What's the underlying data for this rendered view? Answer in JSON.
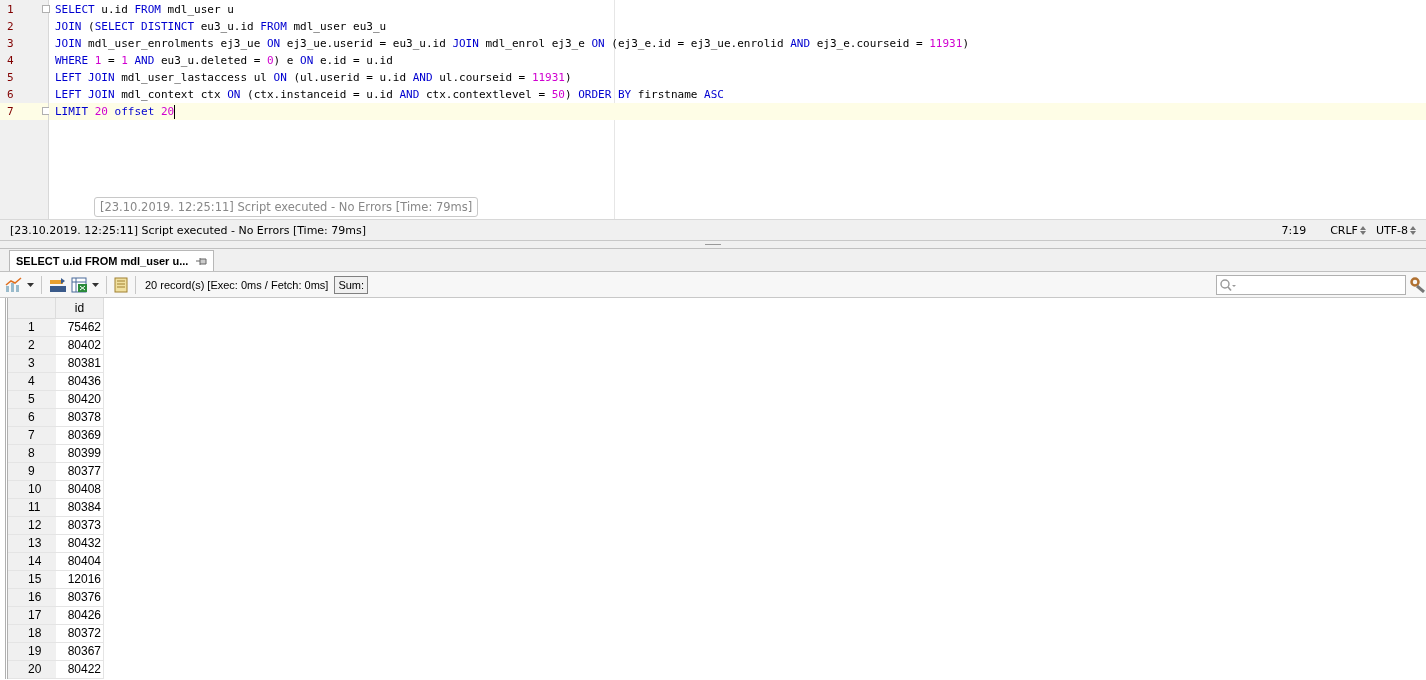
{
  "editor": {
    "lines": [
      {
        "number": "1",
        "fold": true,
        "current": false,
        "tokens": [
          {
            "kind": "keyword",
            "text": "SELECT"
          },
          {
            "kind": "plain",
            "text": " u.id "
          },
          {
            "kind": "keyword",
            "text": "FROM"
          },
          {
            "kind": "plain",
            "text": " mdl_user u"
          }
        ]
      },
      {
        "number": "2",
        "fold": false,
        "current": false,
        "tokens": [
          {
            "kind": "keyword",
            "text": "JOIN"
          },
          {
            "kind": "plain",
            "text": " ("
          },
          {
            "kind": "keyword",
            "text": "SELECT DISTINCT"
          },
          {
            "kind": "plain",
            "text": " eu3_u.id "
          },
          {
            "kind": "keyword",
            "text": "FROM"
          },
          {
            "kind": "plain",
            "text": " mdl_user eu3_u"
          }
        ]
      },
      {
        "number": "3",
        "fold": false,
        "current": false,
        "tokens": [
          {
            "kind": "keyword",
            "text": "JOIN"
          },
          {
            "kind": "plain",
            "text": " mdl_user_enrolments ej3_ue "
          },
          {
            "kind": "keyword",
            "text": "ON"
          },
          {
            "kind": "plain",
            "text": " ej3_ue.userid = eu3_u.id "
          },
          {
            "kind": "keyword",
            "text": "JOIN"
          },
          {
            "kind": "plain",
            "text": " mdl_enrol ej3_e "
          },
          {
            "kind": "keyword",
            "text": "ON"
          },
          {
            "kind": "plain",
            "text": " (ej3_e.id = ej3_ue.enrolid "
          },
          {
            "kind": "keyword",
            "text": "AND"
          },
          {
            "kind": "plain",
            "text": " ej3_e.courseid = "
          },
          {
            "kind": "number",
            "text": "11931"
          },
          {
            "kind": "plain",
            "text": ")"
          }
        ]
      },
      {
        "number": "4",
        "fold": false,
        "current": false,
        "tokens": [
          {
            "kind": "keyword",
            "text": "WHERE "
          },
          {
            "kind": "number",
            "text": "1"
          },
          {
            "kind": "plain",
            "text": " = "
          },
          {
            "kind": "number",
            "text": "1"
          },
          {
            "kind": "keyword",
            "text": " AND"
          },
          {
            "kind": "plain",
            "text": " eu3_u.deleted = "
          },
          {
            "kind": "number",
            "text": "0"
          },
          {
            "kind": "plain",
            "text": ") e "
          },
          {
            "kind": "keyword",
            "text": "ON"
          },
          {
            "kind": "plain",
            "text": " e.id = u.id"
          }
        ]
      },
      {
        "number": "5",
        "fold": false,
        "current": false,
        "tokens": [
          {
            "kind": "keyword",
            "text": "LEFT JOIN"
          },
          {
            "kind": "plain",
            "text": " mdl_user_lastaccess ul "
          },
          {
            "kind": "keyword",
            "text": "ON"
          },
          {
            "kind": "plain",
            "text": " (ul.userid = u.id "
          },
          {
            "kind": "keyword",
            "text": "AND"
          },
          {
            "kind": "plain",
            "text": " ul.courseid = "
          },
          {
            "kind": "number",
            "text": "11931"
          },
          {
            "kind": "plain",
            "text": ")"
          }
        ]
      },
      {
        "number": "6",
        "fold": false,
        "current": false,
        "tokens": [
          {
            "kind": "keyword",
            "text": "LEFT JOIN"
          },
          {
            "kind": "plain",
            "text": " mdl_context ctx "
          },
          {
            "kind": "keyword",
            "text": "ON"
          },
          {
            "kind": "plain",
            "text": " (ctx.instanceid = u.id "
          },
          {
            "kind": "keyword",
            "text": "AND"
          },
          {
            "kind": "plain",
            "text": " ctx.contextlevel = "
          },
          {
            "kind": "number",
            "text": "50"
          },
          {
            "kind": "plain",
            "text": ") "
          },
          {
            "kind": "keyword",
            "text": "ORDER BY"
          },
          {
            "kind": "plain",
            "text": " firstname "
          },
          {
            "kind": "keyword",
            "text": "ASC"
          }
        ]
      },
      {
        "number": "7",
        "fold": true,
        "current": true,
        "tokens": [
          {
            "kind": "keyword",
            "text": "LIMIT "
          },
          {
            "kind": "number",
            "text": "20"
          },
          {
            "kind": "keyword",
            "text": " offset "
          },
          {
            "kind": "number",
            "text": "20"
          }
        ]
      }
    ]
  },
  "tooltip": "[23.10.2019. 12:25:11] Script executed - No Errors [Time: 79ms]",
  "status_bar": {
    "message": "[23.10.2019. 12:25:11] Script executed - No Errors [Time: 79ms]",
    "position": "7:19",
    "line_ending": "CRLF",
    "encoding": "UTF-8"
  },
  "result_tab": {
    "label": "SELECT u.id FROM mdl_user u...",
    "selected": true
  },
  "toolbar": {
    "records": "20 record(s) [Exec: 0ms / Fetch: 0ms]",
    "sum_button": "Sum:"
  },
  "table": {
    "columns": [
      "",
      "id"
    ],
    "rows": [
      [
        "1",
        "75462"
      ],
      [
        "2",
        "80402"
      ],
      [
        "3",
        "80381"
      ],
      [
        "4",
        "80436"
      ],
      [
        "5",
        "80420"
      ],
      [
        "6",
        "80378"
      ],
      [
        "7",
        "80369"
      ],
      [
        "8",
        "80399"
      ],
      [
        "9",
        "80377"
      ],
      [
        "10",
        "80408"
      ],
      [
        "11",
        "80384"
      ],
      [
        "12",
        "80373"
      ],
      [
        "13",
        "80432"
      ],
      [
        "14",
        "80404"
      ],
      [
        "15",
        "12016"
      ],
      [
        "16",
        "80376"
      ],
      [
        "17",
        "80426"
      ],
      [
        "18",
        "80372"
      ],
      [
        "19",
        "80367"
      ],
      [
        "20",
        "80422"
      ]
    ]
  }
}
